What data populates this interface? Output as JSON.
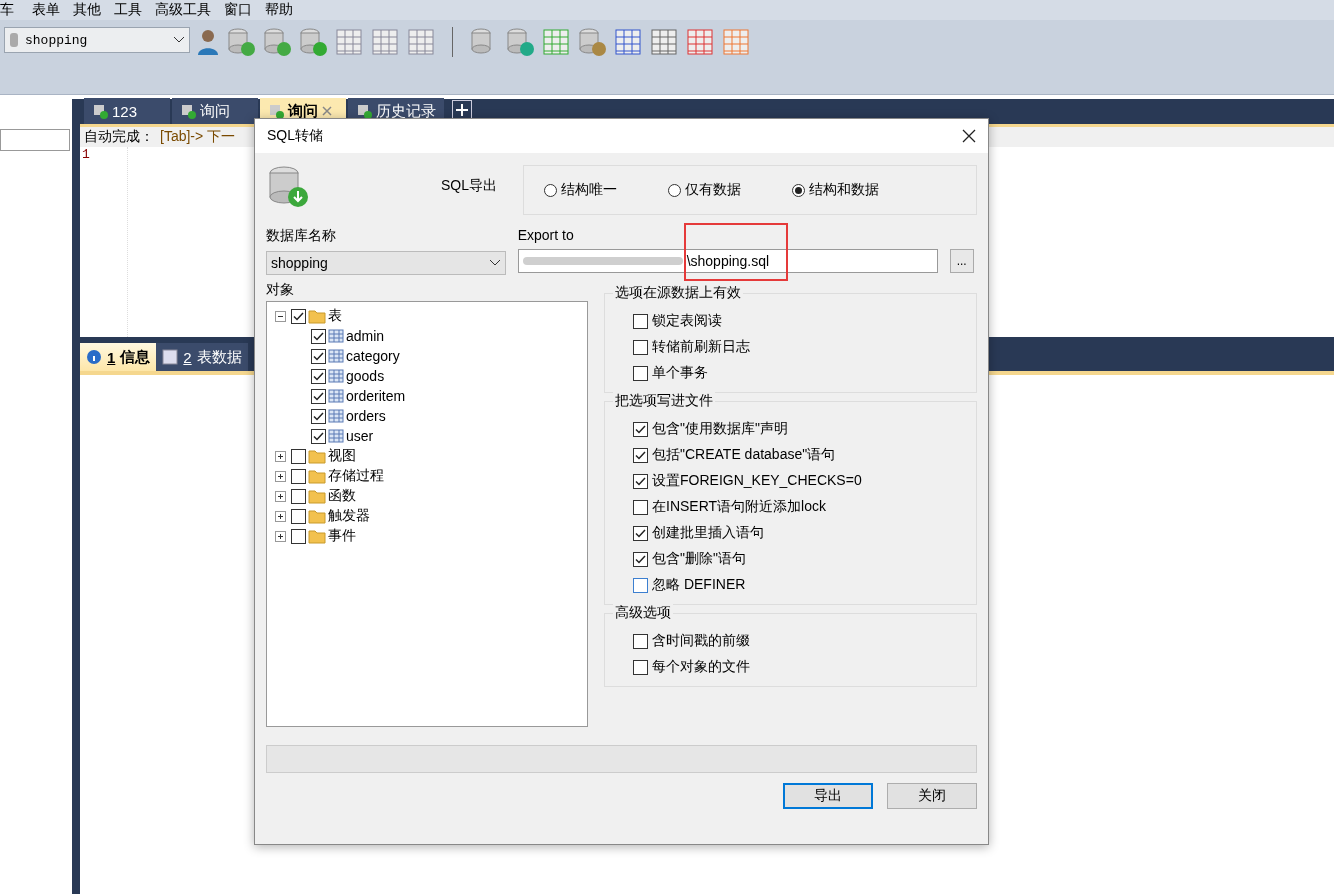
{
  "menu": [
    "车",
    "表单",
    "其他",
    "工具",
    "高级工具",
    "窗口",
    "帮助"
  ],
  "toolbar": {
    "database": "shopping"
  },
  "query_tabs": [
    {
      "label": "123",
      "selected": false,
      "closable": false
    },
    {
      "label": "询问",
      "selected": false,
      "closable": false
    },
    {
      "label": "询问",
      "selected": true,
      "closable": true
    },
    {
      "label": "历史记录",
      "selected": false,
      "closable": false
    }
  ],
  "editor": {
    "hint_label": "自动完成：",
    "hint_key": "[Tab]-> 下一",
    "line_numbers": [
      "1"
    ]
  },
  "result_tabs": [
    {
      "number": "1",
      "label": "信息",
      "selected": true
    },
    {
      "number": "2",
      "label": "表数据",
      "selected": false
    }
  ],
  "dialog": {
    "title": "SQL转储",
    "heading": "SQL导出",
    "modes": [
      {
        "label": "结构唯一",
        "selected": false
      },
      {
        "label": "仅有数据",
        "selected": false
      },
      {
        "label": "结构和数据",
        "selected": true
      }
    ],
    "db_label": "数据库名称",
    "db_value": "shopping",
    "export_label": "Export to",
    "export_path": "\\shopping.sql",
    "export_highlighted": true,
    "browse": "...",
    "objects_label": "对象",
    "tree": [
      {
        "label": "表",
        "kind": "folder",
        "checked": true,
        "expanded": true,
        "children": [
          {
            "label": "admin",
            "kind": "table",
            "checked": true
          },
          {
            "label": "category",
            "kind": "table",
            "checked": true
          },
          {
            "label": "goods",
            "kind": "table",
            "checked": true
          },
          {
            "label": "orderitem",
            "kind": "table",
            "checked": true
          },
          {
            "label": "orders",
            "kind": "table",
            "checked": true
          },
          {
            "label": "user",
            "kind": "table",
            "checked": true
          }
        ]
      },
      {
        "label": "视图",
        "kind": "folder",
        "checked": false,
        "expanded": false
      },
      {
        "label": "存储过程",
        "kind": "folder",
        "checked": false,
        "expanded": false
      },
      {
        "label": "函数",
        "kind": "folder",
        "checked": false,
        "expanded": false
      },
      {
        "label": "触发器",
        "kind": "folder",
        "checked": false,
        "expanded": false
      },
      {
        "label": "事件",
        "kind": "folder",
        "checked": false,
        "expanded": false
      }
    ],
    "option_groups": [
      {
        "title": "选项在源数据上有效",
        "options": [
          {
            "label": "锁定表阅读",
            "checked": false,
            "focused": false
          },
          {
            "label": "转储前刷新日志",
            "checked": false,
            "focused": false
          },
          {
            "label": "单个事务",
            "checked": false,
            "focused": false
          }
        ]
      },
      {
        "title": "把选项写进文件",
        "options": [
          {
            "label": "包含\"使用数据库\"声明",
            "checked": true,
            "focused": false
          },
          {
            "label": "包括\"CREATE database\"语句",
            "checked": true,
            "focused": false
          },
          {
            "label": "设置FOREIGN_KEY_CHECKS=0",
            "checked": true,
            "focused": false
          },
          {
            "label": "在INSERT语句附近添加lock",
            "checked": false,
            "focused": false
          },
          {
            "label": "创建批里插入语句",
            "checked": true,
            "focused": false
          },
          {
            "label": "包含\"删除\"语句",
            "checked": true,
            "focused": false
          },
          {
            "label": "忽略 DEFINER",
            "checked": false,
            "focused": true
          }
        ]
      },
      {
        "title": "高级选项",
        "options": [
          {
            "label": "含时间戳的前缀",
            "checked": false,
            "focused": false
          },
          {
            "label": "每个对象的文件",
            "checked": false,
            "focused": false
          }
        ]
      }
    ],
    "progress": {
      "level": 0
    },
    "buttons": [
      {
        "label": "导出",
        "default": true
      },
      {
        "label": "关闭",
        "default": false
      }
    ]
  }
}
